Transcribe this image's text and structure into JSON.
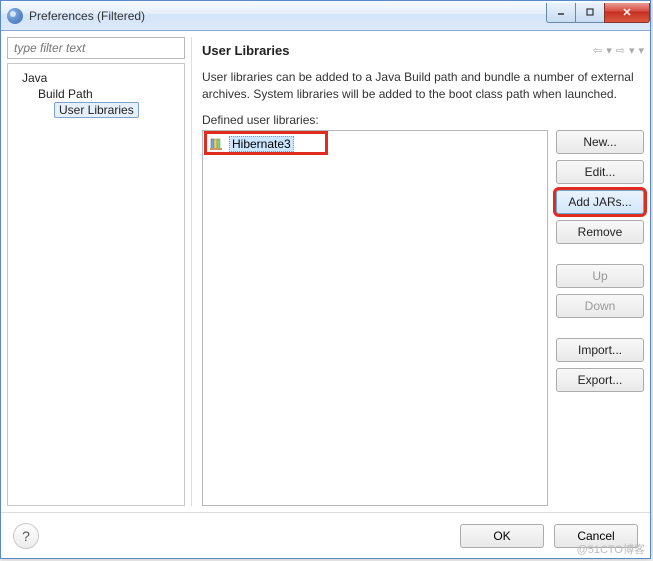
{
  "window": {
    "title": "Preferences (Filtered)"
  },
  "filter": {
    "placeholder": "type filter text"
  },
  "tree": {
    "items": [
      {
        "label": "Java",
        "level": 1
      },
      {
        "label": "Build Path",
        "level": 2
      },
      {
        "label": "User Libraries",
        "level": 3,
        "selected": true
      }
    ]
  },
  "page": {
    "heading": "User Libraries",
    "description": "User libraries can be added to a Java Build path and bundle a number of external archives. System libraries will be added to the boot class path when launched.",
    "defined_label": "Defined user libraries:"
  },
  "libraries": [
    {
      "name": "Hibernate3",
      "selected": true
    }
  ],
  "buttons": {
    "new": "New...",
    "edit": "Edit...",
    "add_jars": "Add JARs...",
    "remove": "Remove",
    "up": "Up",
    "down": "Down",
    "import": "Import...",
    "export": "Export..."
  },
  "dialog": {
    "ok": "OK",
    "cancel": "Cancel",
    "help": "?"
  },
  "watermark": "@51CTO博客"
}
